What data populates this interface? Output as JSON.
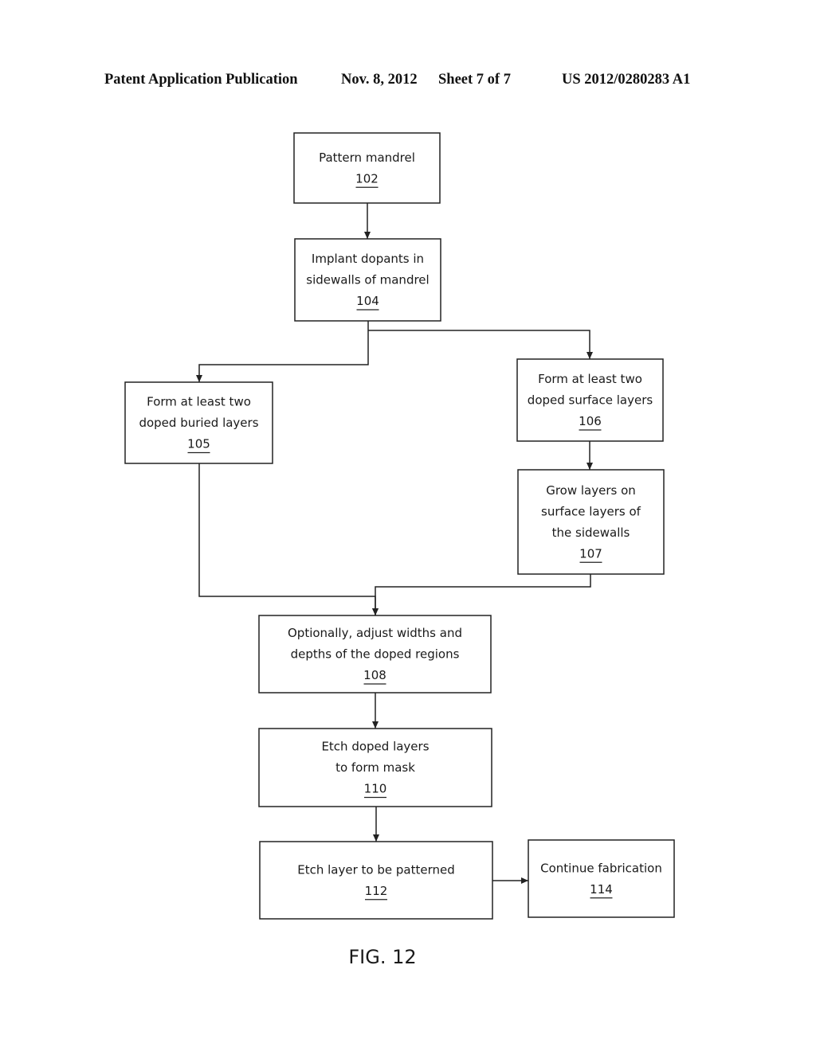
{
  "header": {
    "publication": "Patent Application Publication",
    "date": "Nov. 8, 2012",
    "sheet": "Sheet 7 of 7",
    "number": "US 2012/0280283 A1"
  },
  "figure_label": "FIG. 12",
  "steps": [
    {
      "id": "102",
      "lines": [
        "Pattern mandrel"
      ],
      "ref": "102"
    },
    {
      "id": "104",
      "lines": [
        "Implant dopants in",
        "sidewalls of mandrel"
      ],
      "ref": "104"
    },
    {
      "id": "105",
      "lines": [
        "Form at least two",
        "doped buried layers"
      ],
      "ref": "105"
    },
    {
      "id": "106",
      "lines": [
        "Form at least two",
        "doped surface layers"
      ],
      "ref": "106"
    },
    {
      "id": "107",
      "lines": [
        "Grow layers on",
        "surface layers of",
        "the sidewalls"
      ],
      "ref": "107"
    },
    {
      "id": "108",
      "lines": [
        "Optionally, adjust widths and",
        "depths of the doped regions"
      ],
      "ref": "108"
    },
    {
      "id": "110",
      "lines": [
        "Etch doped layers",
        "to form mask"
      ],
      "ref": "110"
    },
    {
      "id": "112",
      "lines": [
        "Etch layer to be patterned"
      ],
      "ref": "112"
    },
    {
      "id": "114",
      "lines": [
        "Continue fabrication"
      ],
      "ref": "114"
    }
  ],
  "connections": [
    {
      "from": "102",
      "to": "104"
    },
    {
      "from": "104",
      "to": "105"
    },
    {
      "from": "104",
      "to": "106"
    },
    {
      "from": "106",
      "to": "107"
    },
    {
      "from": "105",
      "to": "108"
    },
    {
      "from": "107",
      "to": "108"
    },
    {
      "from": "108",
      "to": "110"
    },
    {
      "from": "110",
      "to": "112"
    },
    {
      "from": "112",
      "to": "114"
    }
  ]
}
